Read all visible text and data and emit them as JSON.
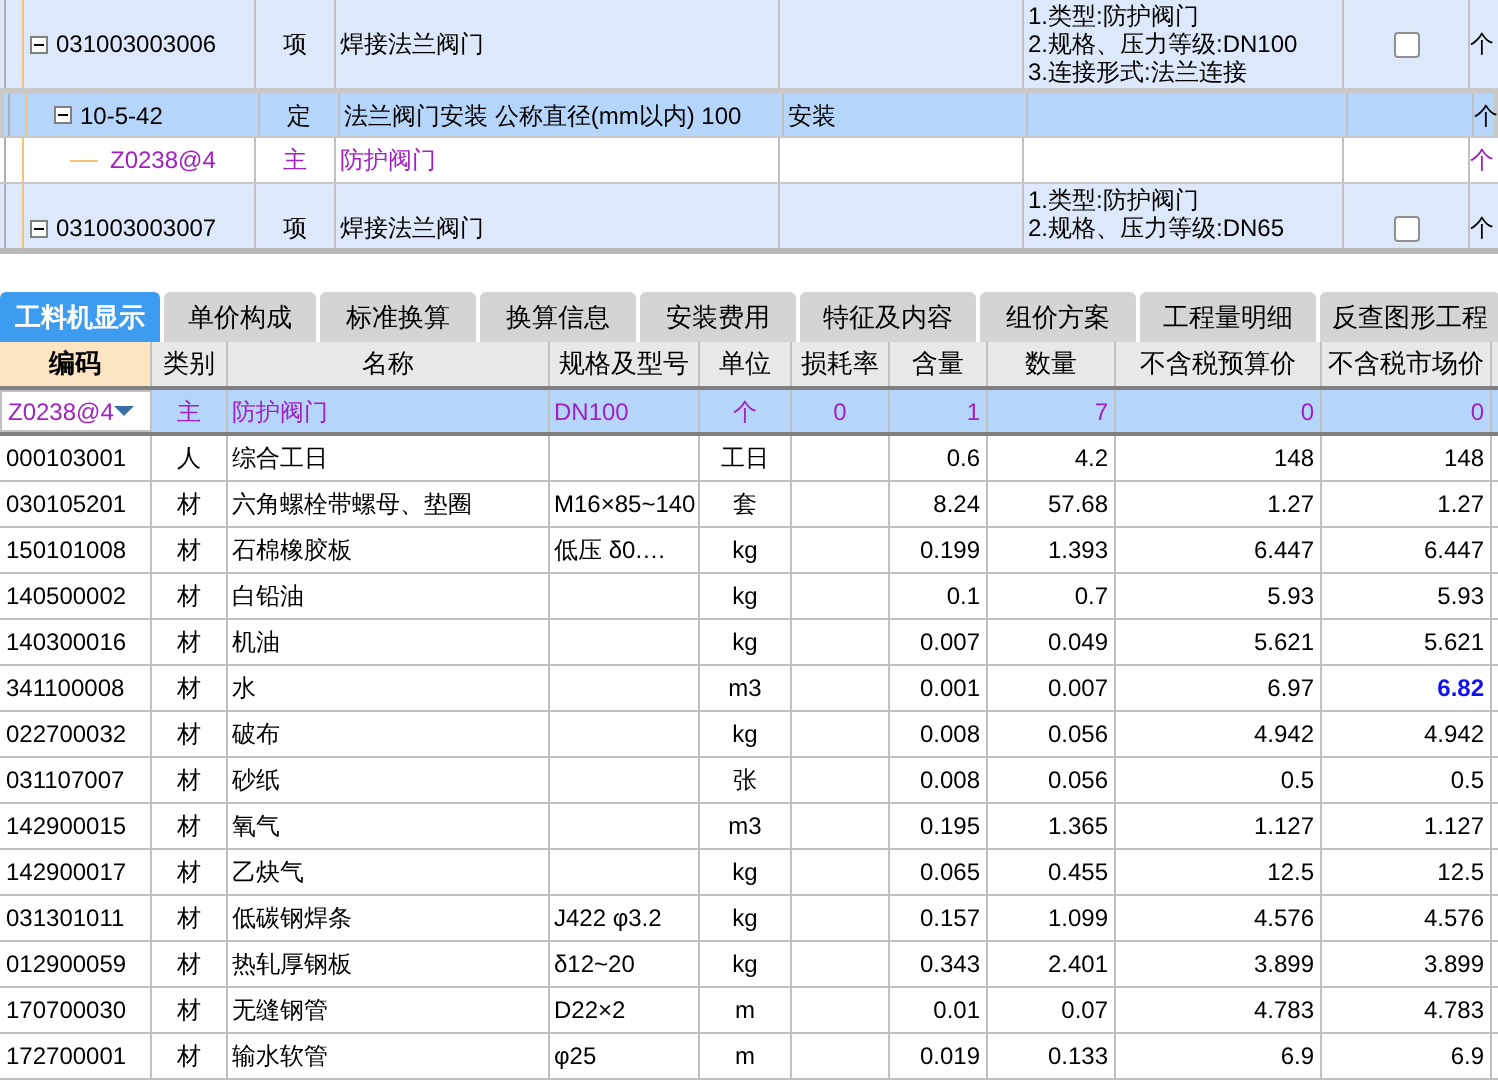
{
  "bill_rows": [
    {
      "kind": "item",
      "code": "031003003006",
      "type": "项",
      "name": "焊接法兰阀门",
      "features": [
        "1.类型:防护阀门",
        "2.规格、压力等级:DN100",
        "3.连接形式:法兰连接"
      ],
      "checked": false,
      "unit": "个",
      "selected": false,
      "expanded": true,
      "children": [
        {
          "kind": "quota",
          "code": "10-5-42",
          "type": "定",
          "name": "法兰阀门安装 公称直径(mm以内) 100",
          "content": "安装",
          "unit": "个",
          "selected": true,
          "expanded": true,
          "children": [
            {
              "kind": "material",
              "code": "Z0238@4",
              "type": "主",
              "name": "防护阀门",
              "unit": "个",
              "selected": false
            }
          ]
        }
      ]
    },
    {
      "kind": "item",
      "code": "031003003007",
      "type": "项",
      "name": "焊接法兰阀门",
      "features": [
        "1.类型:防护阀门",
        "2.规格、压力等级:DN65"
      ],
      "checked": false,
      "unit": "个",
      "selected": false,
      "expanded": true
    }
  ],
  "tabs": [
    {
      "label": "工料机显示",
      "selected": true
    },
    {
      "label": "单价构成",
      "selected": false
    },
    {
      "label": "标准换算",
      "selected": false
    },
    {
      "label": "换算信息",
      "selected": false
    },
    {
      "label": "安装费用",
      "selected": false
    },
    {
      "label": "特征及内容",
      "selected": false
    },
    {
      "label": "组价方案",
      "selected": false
    },
    {
      "label": "工程量明细",
      "selected": false
    },
    {
      "label": "反查图形工程",
      "selected": false
    }
  ],
  "columns": [
    {
      "label": "编码",
      "selected": true
    },
    {
      "label": "类别",
      "selected": false
    },
    {
      "label": "名称",
      "selected": false
    },
    {
      "label": "规格及型号",
      "selected": false
    },
    {
      "label": "单位",
      "selected": false
    },
    {
      "label": "损耗率",
      "selected": false
    },
    {
      "label": "含量",
      "selected": false
    },
    {
      "label": "数量",
      "selected": false
    },
    {
      "label": "不含税预算价",
      "selected": false
    },
    {
      "label": "不含税市场价",
      "selected": false
    }
  ],
  "materials": [
    {
      "kind": "main",
      "code": "Z0238@4",
      "category": "主",
      "name": "防护阀门",
      "spec": "DN100",
      "unit": "个",
      "loss": "0",
      "content": "1",
      "quantity": "7",
      "budget_price": "0",
      "market_price": "0",
      "selected": true,
      "changed": false
    },
    {
      "kind": "normal",
      "code": "000103001",
      "category": "人",
      "name": "综合工日",
      "unit": "工日",
      "content": "0.6",
      "quantity": "4.2",
      "budget_price": "148",
      "market_price": "148",
      "selected": false,
      "changed": false
    },
    {
      "kind": "normal",
      "code": "030105201",
      "category": "材",
      "name": "六角螺栓带螺母、垫圈",
      "spec": "M16×85~140",
      "unit": "套",
      "content": "8.24",
      "quantity": "57.68",
      "budget_price": "1.27",
      "market_price": "1.27",
      "selected": false,
      "changed": false
    },
    {
      "kind": "normal",
      "code": "150101008",
      "category": "材",
      "name": "石棉橡胶板",
      "spec": "低压 δ0.…",
      "unit": "kg",
      "content": "0.199",
      "quantity": "1.393",
      "budget_price": "6.447",
      "market_price": "6.447",
      "selected": false,
      "changed": false
    },
    {
      "kind": "normal",
      "code": "140500002",
      "category": "材",
      "name": "白铅油",
      "unit": "kg",
      "content": "0.1",
      "quantity": "0.7",
      "budget_price": "5.93",
      "market_price": "5.93",
      "selected": false,
      "changed": false
    },
    {
      "kind": "normal",
      "code": "140300016",
      "category": "材",
      "name": "机油",
      "unit": "kg",
      "content": "0.007",
      "quantity": "0.049",
      "budget_price": "5.621",
      "market_price": "5.621",
      "selected": false,
      "changed": false
    },
    {
      "kind": "normal",
      "code": "341100008",
      "category": "材",
      "name": "水",
      "unit": "m3",
      "content": "0.001",
      "quantity": "0.007",
      "budget_price": "6.97",
      "market_price": "6.82",
      "selected": false,
      "changed": true
    },
    {
      "kind": "normal",
      "code": "022700032",
      "category": "材",
      "name": "破布",
      "unit": "kg",
      "content": "0.008",
      "quantity": "0.056",
      "budget_price": "4.942",
      "market_price": "4.942",
      "selected": false,
      "changed": false
    },
    {
      "kind": "normal",
      "code": "031107007",
      "category": "材",
      "name": "砂纸",
      "unit": "张",
      "content": "0.008",
      "quantity": "0.056",
      "budget_price": "0.5",
      "market_price": "0.5",
      "selected": false,
      "changed": false
    },
    {
      "kind": "normal",
      "code": "142900015",
      "category": "材",
      "name": "氧气",
      "unit": "m3",
      "content": "0.195",
      "quantity": "1.365",
      "budget_price": "1.127",
      "market_price": "1.127",
      "selected": false,
      "changed": false
    },
    {
      "kind": "normal",
      "code": "142900017",
      "category": "材",
      "name": "乙炔气",
      "unit": "kg",
      "content": "0.065",
      "quantity": "0.455",
      "budget_price": "12.5",
      "market_price": "12.5",
      "selected": false,
      "changed": false
    },
    {
      "kind": "normal",
      "code": "031301011",
      "category": "材",
      "name": "低碳钢焊条",
      "spec": "J422 φ3.2",
      "unit": "kg",
      "content": "0.157",
      "quantity": "1.099",
      "budget_price": "4.576",
      "market_price": "4.576",
      "selected": false,
      "changed": false
    },
    {
      "kind": "normal",
      "code": "012900059",
      "category": "材",
      "name": "热轧厚钢板",
      "spec": "δ12~20",
      "unit": "kg",
      "content": "0.343",
      "quantity": "2.401",
      "budget_price": "3.899",
      "market_price": "3.899",
      "selected": false,
      "changed": false
    },
    {
      "kind": "normal",
      "code": "170700030",
      "category": "材",
      "name": "无缝钢管",
      "spec": "D22×2",
      "unit": "m",
      "content": "0.01",
      "quantity": "0.07",
      "budget_price": "4.783",
      "market_price": "4.783",
      "selected": false,
      "changed": false
    },
    {
      "kind": "normal",
      "code": "172700001",
      "category": "材",
      "name": "输水软管",
      "spec": "φ25",
      "unit": "m",
      "content": "0.019",
      "quantity": "0.133",
      "budget_price": "6.9",
      "market_price": "6.9",
      "selected": false,
      "changed": false
    }
  ]
}
